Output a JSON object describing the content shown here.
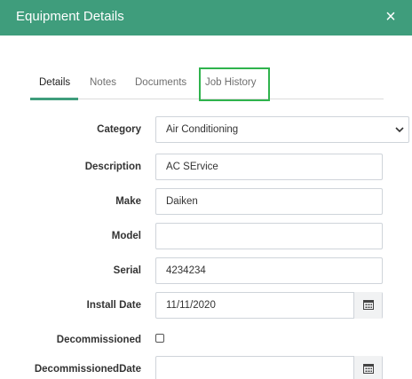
{
  "header": {
    "title": "Equipment Details",
    "close_icon": "×"
  },
  "tabs": [
    {
      "label": "Details",
      "active": true
    },
    {
      "label": "Notes",
      "active": false
    },
    {
      "label": "Documents",
      "active": false
    },
    {
      "label": "Job History",
      "active": false,
      "highlighted": true
    }
  ],
  "form": {
    "category": {
      "label": "Category",
      "value": "Air Conditioning"
    },
    "description": {
      "label": "Description",
      "value": "AC SErvice"
    },
    "make": {
      "label": "Make",
      "value": "Daiken"
    },
    "model": {
      "label": "Model",
      "value": ""
    },
    "serial": {
      "label": "Serial",
      "value": "4234234"
    },
    "install_date": {
      "label": "Install Date",
      "value": "11/11/2020"
    },
    "decommissioned": {
      "label": "Decommissioned",
      "checked": false
    },
    "decommissioned_date": {
      "label": "DecommissionedDate",
      "value": ""
    }
  },
  "colors": {
    "header_bg": "#3f9d7c",
    "tab_underline": "#3f9d7c",
    "highlight_border": "#2fb34d"
  },
  "icons": {
    "close": "close-icon",
    "dropdown": "chevron-down-icon",
    "calendar": "calendar-icon"
  }
}
